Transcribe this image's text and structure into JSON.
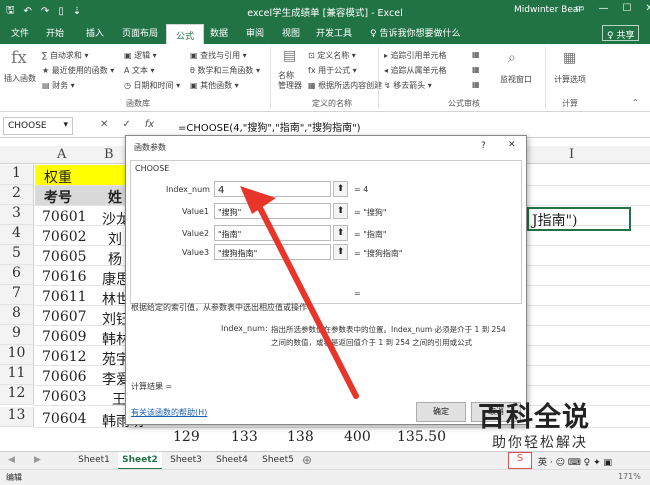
{
  "titlebar": {
    "qa_icons": [
      "save-icon",
      "undo-icon",
      "redo-icon",
      "new-doc-icon",
      "customize-icon"
    ],
    "title": "excel学生成绩单 [兼容模式] - Excel",
    "user": "Midwinter Bear",
    "window_controls": [
      "▭",
      "—",
      "☐",
      "✕"
    ]
  },
  "tabs": [
    "文件",
    "开始",
    "插入",
    "页面布局",
    "公式",
    "数据",
    "审阅",
    "视图",
    "开发工具",
    "♀ 告诉我你想要做什么"
  ],
  "active_tab": "公式",
  "share": "♀ 共享",
  "ribbon": {
    "insert_function": "插入函数",
    "col1": [
      "∑ 自动求和 ▾",
      "★ 最近使用的函数 ▾",
      "▤ 财务 ▾"
    ],
    "col2": [
      "▣ 逻辑 ▾",
      "A 文本 ▾",
      "◷ 日期和时间 ▾"
    ],
    "col3": [
      "▣ 查找与引用 ▾",
      "θ 数学和三角函数 ▾",
      "▣ 其他函数 ▾"
    ],
    "function_library": "函数库",
    "name_manager": "名称\n管理器",
    "names": [
      "⊡ 定义名称 ▾",
      "fx 用于公式 ▾",
      "▦ 根据所选内容创建"
    ],
    "defined_names": "定义的名称",
    "audit": [
      "▸ 追踪引用单元格",
      "◂ 追踪从属单元格",
      "↯ 移去箭头 ▾"
    ],
    "audit2": [
      "▦",
      "▦",
      "▦"
    ],
    "watch": "监视窗口",
    "formula_audit": "公式审核",
    "calc_options": "计算选项",
    "calculation": "计算"
  },
  "formula_bar": {
    "name_box": "CHOOSE",
    "formula": "=CHOOSE(4,\"搜狗\",\"指南\",\"搜狗指南\")"
  },
  "grid": {
    "col_headers": [
      "A",
      "B",
      "I"
    ],
    "rows": [
      "1",
      "2",
      "3",
      "4",
      "5",
      "6",
      "7",
      "8",
      "9",
      "10",
      "11",
      "12",
      "13"
    ],
    "row1_a": "权重",
    "row2": [
      "考号",
      "姓"
    ],
    "col_a": [
      "70601",
      "70602",
      "70605",
      "70616",
      "70611",
      "70607",
      "70609",
      "70612",
      "70606",
      "70603",
      "70604"
    ],
    "col_b": [
      "沙龙",
      "刘",
      "杨",
      "康思",
      "林世",
      "刘钰",
      "韩林",
      "苑宇",
      "李爱",
      "王",
      "韩雨萌"
    ],
    "row13_rest": [
      "129",
      "133",
      "138",
      "400",
      "135.50"
    ],
    "cell_text_row3": "J指南\")"
  },
  "dialog": {
    "title": "函数参数",
    "help": "?",
    "close": "✕",
    "func": "CHOOSE",
    "args": [
      {
        "label": "Index_num",
        "value": "4",
        "result": "= 4"
      },
      {
        "label": "Value1",
        "value": "\"搜狗\"",
        "result": "= \"搜狗\""
      },
      {
        "label": "Value2",
        "value": "\"指南\"",
        "result": "= \"指南\""
      },
      {
        "label": "Value3",
        "value": "\"搜狗指南\"",
        "result": "= \"搜狗指南\""
      }
    ],
    "total_eq": "=",
    "desc": "根据给定的索引值，从参数表中选出相应值或操作",
    "arg_name": "Index_num:",
    "arg_desc1": "指出所选参数值在参数表中的位置。Index_num 必须是介于 1 到 254",
    "arg_desc2": "之间的数值，或者是返回值介于 1 到 254 之间的引用或公式",
    "calc_result": "计算结果 =",
    "help_link": "有关该函数的帮助(H)",
    "ok": "确定",
    "cancel": "取消"
  },
  "watermark": {
    "line1": "百科全说",
    "line2": "助你轻松解决"
  },
  "sheets": [
    "Sheet1",
    "Sheet2",
    "Sheet3",
    "Sheet4",
    "Sheet5"
  ],
  "active_sheet": "Sheet2",
  "status": {
    "left": "编辑",
    "zoom": "171%"
  },
  "colors": {
    "excel_green": "#217346",
    "highlight_yellow": "#ffff00",
    "arrow_red": "#e8352a"
  }
}
